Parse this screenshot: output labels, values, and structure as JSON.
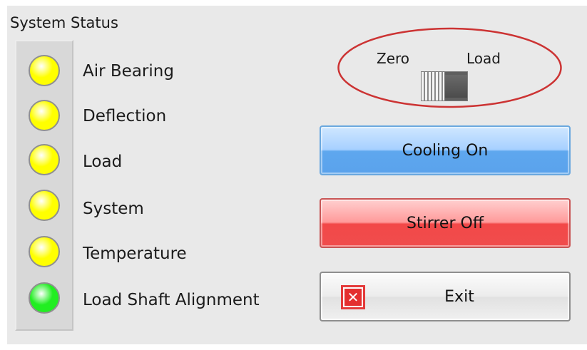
{
  "system_status": {
    "title": "System Status",
    "indicators": [
      {
        "label": "Air Bearing",
        "state": "yellow",
        "color": "#ffff00"
      },
      {
        "label": "Deflection",
        "state": "yellow",
        "color": "#ffff00"
      },
      {
        "label": "Load",
        "state": "yellow",
        "color": "#ffff00"
      },
      {
        "label": "System",
        "state": "yellow",
        "color": "#ffff00"
      },
      {
        "label": "Temperature",
        "state": "yellow",
        "color": "#ffff00"
      },
      {
        "label": "Load Shaft Alignment",
        "state": "green",
        "color": "#22ee22"
      }
    ]
  },
  "mode_toggle": {
    "left_label": "Zero",
    "right_label": "Load",
    "position": "Zero",
    "highlight_color": "#cc3333"
  },
  "buttons": {
    "cooling_label": "Cooling On",
    "stirrer_label": "Stirrer Off",
    "exit_label": "Exit"
  },
  "icons": {
    "exit": "close-x-icon",
    "toggle": "slide-switch-icon"
  }
}
